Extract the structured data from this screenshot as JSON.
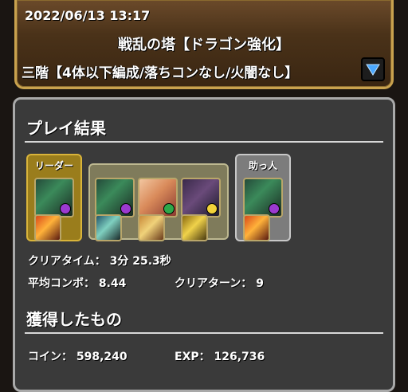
{
  "header": {
    "datetime": "2022/06/13 13:17",
    "dungeon_name": "戦乱の塔【ドラゴン強化】",
    "floor_name": "三階【4体以下編成/落ちコンなし/火闇なし】",
    "dropdown_icon": "triangle-down-icon"
  },
  "result": {
    "title": "プレイ結果",
    "leader_label": "リーダー",
    "helper_label": "助っ人",
    "clear_time_label": "クリアタイム：",
    "clear_time_value": "3分 25.3秒",
    "avg_combo_label": "平均コンボ：",
    "avg_combo_value": "8.44",
    "clear_turns_label": "クリアターン：",
    "clear_turns_value": "9"
  },
  "rewards": {
    "title": "獲得したもの",
    "coin_label": "コイン：",
    "coin_value": "598,240",
    "exp_label": "EXP：",
    "exp_value": "126,736"
  },
  "colors": {
    "header_border": "#c9a24e",
    "panel_bg": "#3a3a3a",
    "leader_box": "#9a7d1c",
    "sub_box": "#7f7b5b",
    "helper_box": "#7c7c7c",
    "attr_dark": "#9b3ad0",
    "attr_wood": "#2ea84a",
    "attr_light": "#f2d23a"
  }
}
